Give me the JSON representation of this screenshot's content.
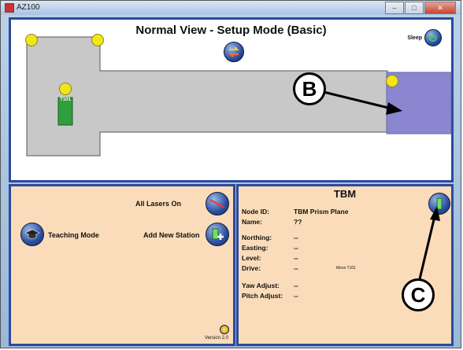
{
  "window": {
    "title": "AZ100",
    "buttons": [
      "–",
      "□",
      "✕"
    ]
  },
  "top_panel": {
    "title": "Normal View - Setup Mode (Basic)",
    "sleep_label": "Sleep",
    "station_label": "T101",
    "callout_b": "B",
    "colors": {
      "floor": "#c8c8c8",
      "zone": "#8a86d0",
      "station": "#2f9e3d",
      "node": "#f2e61b"
    }
  },
  "bottom_left": {
    "all_lasers_label": "All Lasers On",
    "add_station_label": "Add New Station",
    "teaching_mode_label": "Teaching Mode",
    "version_label": "Version 2.0"
  },
  "bottom_right": {
    "title": "TBM",
    "callout_c": "C",
    "fields": [
      {
        "label": "Node ID:",
        "value": "TBM Prism Plane"
      },
      {
        "label": "Name:",
        "value": "??"
      },
      {
        "label": "Northing:",
        "value": "--"
      },
      {
        "label": "Easting:",
        "value": "--"
      },
      {
        "label": "Level:",
        "value": "--"
      },
      {
        "label": "Drive:",
        "value": "--"
      },
      {
        "label": "Yaw Adjust:",
        "value": "--"
      },
      {
        "label": "Pitch Adjust:",
        "value": "--"
      }
    ],
    "drive_note": "Move T101"
  }
}
